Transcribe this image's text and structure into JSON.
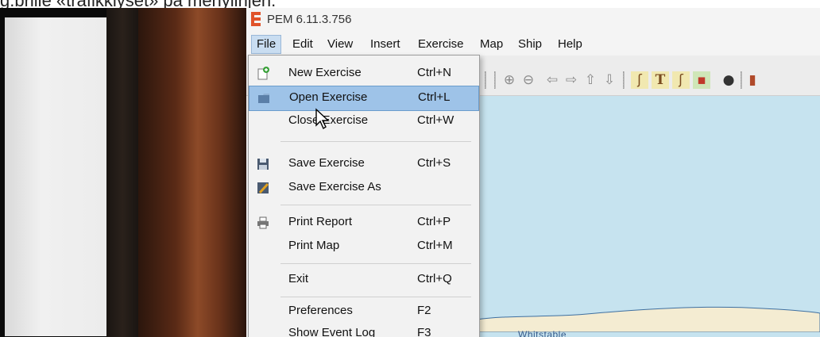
{
  "caption": "g.brille «trafikklyset» på menylinjen.",
  "window": {
    "title": "PEM 6.11.3.756"
  },
  "menubar": [
    {
      "label": "File",
      "active": true
    },
    {
      "label": "Edit"
    },
    {
      "label": "View"
    },
    {
      "label": "Insert"
    },
    {
      "label": "Exercise"
    },
    {
      "label": "Map"
    },
    {
      "label": "Ship"
    },
    {
      "label": "Help"
    }
  ],
  "toolbar_icons": [
    "zoom-in-icon",
    "zoom-out-icon",
    "pan-left-icon",
    "pan-right-icon",
    "pan-up-icon",
    "pan-down-icon",
    "route-icon",
    "text-icon",
    "line-icon",
    "chart-icon",
    "globe-icon"
  ],
  "file_menu": {
    "items": [
      {
        "icon": "new-exercise-icon",
        "label": "New Exercise",
        "shortcut": "Ctrl+N"
      },
      {
        "icon": "open-exercise-icon",
        "label": "Open Exercise",
        "shortcut": "Ctrl+L",
        "highlighted": true
      },
      {
        "icon": "",
        "label": "Close Exercise",
        "shortcut": "Ctrl+W"
      },
      {
        "icon": "save-icon",
        "label": "Save Exercise",
        "shortcut": "Ctrl+S"
      },
      {
        "icon": "save-as-icon",
        "label": "Save Exercise As",
        "shortcut": ""
      },
      {
        "icon": "print-icon",
        "label": "Print Report",
        "shortcut": "Ctrl+P"
      },
      {
        "icon": "",
        "label": "Print Map",
        "shortcut": "Ctrl+M"
      },
      {
        "icon": "",
        "label": "Exit",
        "shortcut": "Ctrl+Q"
      },
      {
        "icon": "",
        "label": "Preferences",
        "shortcut": "F2"
      },
      {
        "icon": "",
        "label": "Show Event Log",
        "shortcut": "F3"
      }
    ]
  },
  "map": {
    "place_label": "Whitstable"
  },
  "colors": {
    "menu_highlight": "#9ec3e8",
    "sea": "#c6e3ef",
    "land": "#f4ecd2",
    "logo": "#e0532a"
  }
}
